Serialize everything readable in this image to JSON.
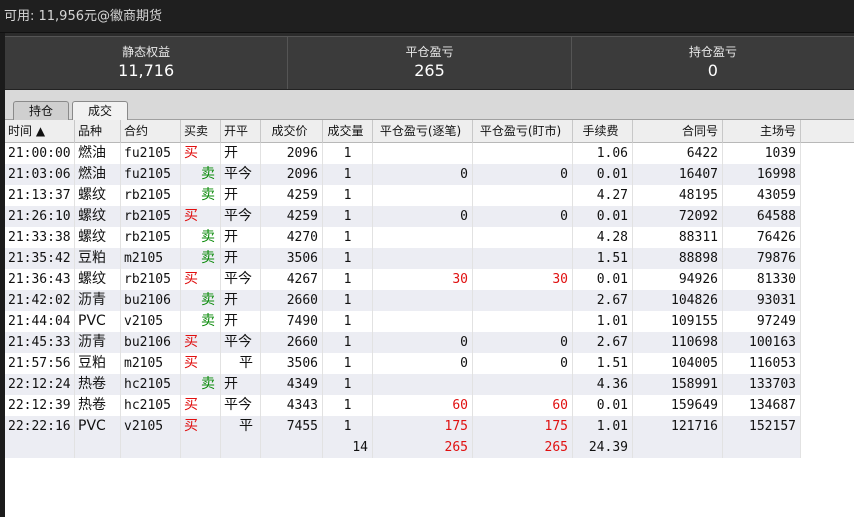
{
  "topbar": {
    "text": "可用: 11,956元@徽商期货"
  },
  "stats": [
    {
      "label": "静态权益",
      "value": "11,716"
    },
    {
      "label": "平仓盈亏",
      "value": "265"
    },
    {
      "label": "持仓盈亏",
      "value": "0"
    }
  ],
  "tabs": [
    {
      "label": "持仓"
    },
    {
      "label": "成交"
    }
  ],
  "table": {
    "headers": [
      "时间 ▲",
      "品种",
      "合约",
      "买卖",
      "开平",
      "成交价",
      "成交量",
      "平仓盈亏(逐笔)",
      "平仓盈亏(盯市)",
      "手续费",
      "合同号",
      "主场号"
    ],
    "rows": [
      [
        "21:00:00",
        "燃油",
        "fu2105",
        "买",
        "开",
        "2096",
        "1",
        "",
        "",
        "1.06",
        "6422",
        "1039"
      ],
      [
        "21:03:06",
        "燃油",
        "fu2105",
        "卖",
        "平今",
        "2096",
        "1",
        "0",
        "0",
        "0.01",
        "16407",
        "16998"
      ],
      [
        "21:13:37",
        "螺纹",
        "rb2105",
        "卖",
        "开",
        "4259",
        "1",
        "",
        "",
        "4.27",
        "48195",
        "43059"
      ],
      [
        "21:26:10",
        "螺纹",
        "rb2105",
        "买",
        "平今",
        "4259",
        "1",
        "0",
        "0",
        "0.01",
        "72092",
        "64588"
      ],
      [
        "21:33:38",
        "螺纹",
        "rb2105",
        "卖",
        "开",
        "4270",
        "1",
        "",
        "",
        "4.28",
        "88311",
        "76426"
      ],
      [
        "21:35:42",
        "豆粕",
        "m2105",
        "卖",
        "开",
        "3506",
        "1",
        "",
        "",
        "1.51",
        "88898",
        "79876"
      ],
      [
        "21:36:43",
        "螺纹",
        "rb2105",
        "买",
        "平今",
        "4267",
        "1",
        "30",
        "30",
        "0.01",
        "94926",
        "81330"
      ],
      [
        "21:42:02",
        "沥青",
        "bu2106",
        "卖",
        "开",
        "2660",
        "1",
        "",
        "",
        "2.67",
        "104826",
        "93031"
      ],
      [
        "21:44:04",
        "PVC",
        "v2105",
        "卖",
        "开",
        "7490",
        "1",
        "",
        "",
        "1.01",
        "109155",
        "97249"
      ],
      [
        "21:45:33",
        "沥青",
        "bu2106",
        "买",
        "平今",
        "2660",
        "1",
        "0",
        "0",
        "2.67",
        "110698",
        "100163"
      ],
      [
        "21:57:56",
        "豆粕",
        "m2105",
        "买",
        "平",
        "3506",
        "1",
        "0",
        "0",
        "1.51",
        "104005",
        "116053"
      ],
      [
        "22:12:24",
        "热卷",
        "hc2105",
        "卖",
        "开",
        "4349",
        "1",
        "",
        "",
        "4.36",
        "158991",
        "133703"
      ],
      [
        "22:12:39",
        "热卷",
        "hc2105",
        "买",
        "平今",
        "4343",
        "1",
        "60",
        "60",
        "0.01",
        "159649",
        "134687"
      ],
      [
        "22:22:16",
        "PVC",
        "v2105",
        "买",
        "平",
        "7455",
        "1",
        "175",
        "175",
        "1.01",
        "121716",
        "152157"
      ]
    ],
    "totals": {
      "volume": "14",
      "pnl_trade": "265",
      "pnl_mark": "265",
      "fee": "24.39"
    }
  },
  "colors": {
    "buy": "#e01010",
    "sell": "#0a8a0a",
    "profit": "#e01010"
  }
}
